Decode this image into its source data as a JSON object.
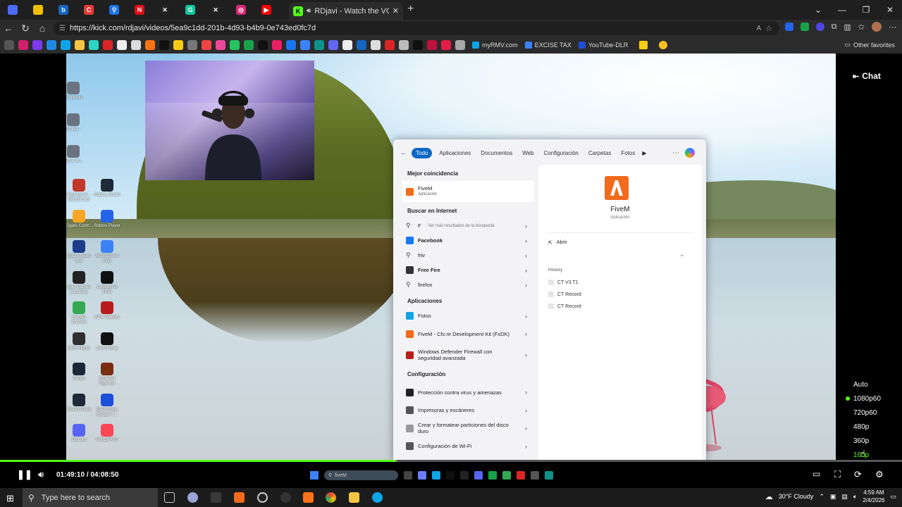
{
  "browser": {
    "pinned_tabs": [
      {
        "icon": "pinwheel-icon",
        "color": "#4a6cf7"
      },
      {
        "icon": "colorbars-icon",
        "color": "#f0c000"
      },
      {
        "icon": "b-logo-icon",
        "color": "#1565c0",
        "glyph": "b"
      },
      {
        "icon": "c-logo-icon",
        "color": "#e53935",
        "glyph": "C"
      },
      {
        "icon": "search-icon",
        "color": "#1a73e8",
        "glyph": "⚲"
      },
      {
        "icon": "netflix-icon",
        "color": "#e50914",
        "glyph": "N"
      },
      {
        "icon": "x-icon",
        "color": "#222222",
        "glyph": "✕"
      },
      {
        "icon": "grammarly-icon",
        "color": "#15c39a",
        "glyph": "G"
      },
      {
        "icon": "x-icon",
        "color": "#222222",
        "glyph": "✕"
      },
      {
        "icon": "instagram-icon",
        "color": "#d62976",
        "glyph": "◎"
      },
      {
        "icon": "youtube-icon",
        "color": "#ff0000",
        "glyph": "▶"
      }
    ],
    "active_tab": {
      "title": "RDjavi - Watch the VOD on Ki",
      "favicon": "K"
    },
    "url": "https://kick.com/rdjavi/videos/5ea9c1dd-201b-4d93-b4b9-0e743ed0fc7d",
    "bookmarks_named": [
      "myRMV.com",
      "EXCISE TAX",
      "YouTube-DLR"
    ],
    "other_favorites": "Other favorites"
  },
  "player": {
    "chat_label": "Chat",
    "time_current": "01:49:10",
    "time_total": "04:08:50",
    "progress_fraction": 0.438,
    "buffered_fraction": 0.44,
    "quality_options": [
      "Auto",
      "1080p60",
      "720p60",
      "480p",
      "360p",
      "160p"
    ],
    "quality_selected": "1080p60",
    "accent": "#53fc18"
  },
  "desktop": {
    "icons_left": [
      {
        "label": "Superposit... Benchmark",
        "color": "#c0392b"
      },
      {
        "label": "Elgato Contr...",
        "color": "#f5a623"
      },
      {
        "label": "Elgato Wave Link",
        "color": "#1e3a8a"
      },
      {
        "label": "Epic Games Launcher",
        "color": "#222222"
      },
      {
        "label": "Google Chrome",
        "color": "#34a853"
      },
      {
        "label": "OBS Studio",
        "color": "#302e31"
      },
      {
        "label": "Steam",
        "color": "#1b2838"
      },
      {
        "label": "Stream Deck",
        "color": "#1f2937"
      },
      {
        "label": "Discord",
        "color": "#5865f2"
      }
    ],
    "icons_right": [
      {
        "label": "Roblox Studio",
        "color": "#1f2937"
      },
      {
        "label": "Roblox Player",
        "color": "#2563eb"
      },
      {
        "label": "ASUS Driver Hub",
        "color": "#3b82f6"
      },
      {
        "label": "Logitech G HUB",
        "color": "#111111"
      },
      {
        "label": "ARC Raiders",
        "color": "#b91c1c"
      },
      {
        "label": "Call of Duty",
        "color": "#111111"
      },
      {
        "label": "Chained Together",
        "color": "#7c2d12"
      },
      {
        "label": "Backrooms Escape T...",
        "color": "#1d4ed8"
      },
      {
        "label": "VALORANT",
        "color": "#ff4655"
      }
    ],
    "icons_top_partial": [
      {
        "label": "Pepperoni",
        "color": "#6b7280"
      },
      {
        "label": "Grand...",
        "color": "#6b7280"
      },
      {
        "label": "Iniciar en...",
        "color": "#6b7280"
      }
    ]
  },
  "search_panel": {
    "tabs": [
      "Todo",
      "Aplicaciones",
      "Documentos",
      "Web",
      "Configuración",
      "Carpetas",
      "Fotos"
    ],
    "best_match_heading": "Mejor coincidencia",
    "best_match": {
      "name": "FiveM",
      "type": "Aplicación"
    },
    "internet_heading": "Buscar en Internet",
    "internet_items": [
      {
        "label": "F",
        "sub": "- Ver más resultados de la búsqueda",
        "icon": "search-icon"
      },
      {
        "label": "Facebook",
        "sub": "",
        "icon": "facebook-icon",
        "bold": true
      },
      {
        "label": "friv",
        "sub": "",
        "icon": "search-icon"
      },
      {
        "label": "Free Fire",
        "sub": "",
        "icon": "freefire-icon",
        "bold": true
      },
      {
        "label": "firefox",
        "sub": "",
        "icon": "search-icon"
      }
    ],
    "apps_heading": "Aplicaciones",
    "apps": [
      {
        "label": "Fotos",
        "icon": "photos-icon"
      },
      {
        "label": "FiveM - Cfx.re Development Kit (FxDK)",
        "icon": "fivem-icon"
      },
      {
        "label": "Windows Defender Firewall con seguridad avanzada",
        "icon": "firewall-icon"
      }
    ],
    "settings_heading": "Configuración",
    "settings": [
      {
        "label": "Protección contra virus y amenazas",
        "icon": "shield-icon"
      },
      {
        "label": "Impresoras y escáneres",
        "icon": "printer-icon"
      },
      {
        "label": "Crear y formatear particiones del disco duro",
        "icon": "disk-icon"
      },
      {
        "label": "Configuración de Wi-Fi",
        "icon": "wifi-icon"
      }
    ],
    "detail": {
      "name": "FiveM",
      "type": "Aplicación",
      "open_label": "Abrir",
      "history_heading": "History",
      "history": [
        "CT V3 T1",
        "CT Record",
        "CT Record"
      ]
    },
    "taskbar_search_text": "fiveM"
  },
  "taskbar": {
    "search_placeholder": "Type here to search",
    "weather": "30°F  Cloudy",
    "time": "4:59 AM",
    "date": "2/4/2026"
  }
}
